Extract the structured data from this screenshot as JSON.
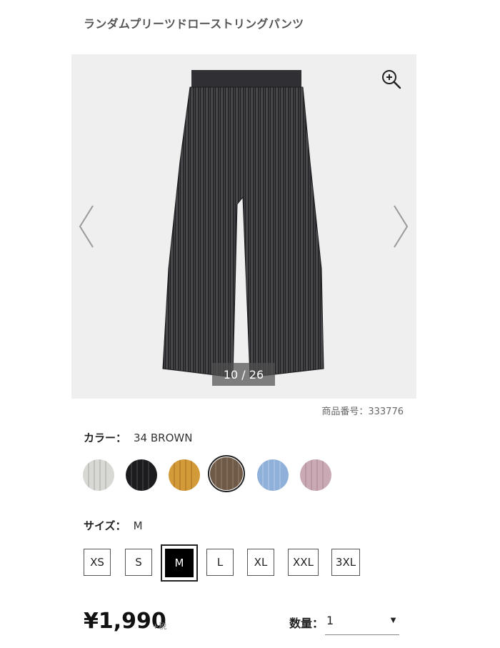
{
  "product": {
    "title": "ランダムプリーツドローストリングパンツ",
    "image_counter": "10 / 26",
    "code_label": "商品番号：333776"
  },
  "color": {
    "label": "カラー：",
    "selected_value": "34 BROWN",
    "swatches": [
      {
        "name": "light-gray",
        "hex": "#d8d8d4"
      },
      {
        "name": "black",
        "hex": "#1c1c1e"
      },
      {
        "name": "mustard",
        "hex": "#d39a3a"
      },
      {
        "name": "brown",
        "hex": "#6f5a48"
      },
      {
        "name": "light-blue",
        "hex": "#8fb0d8"
      },
      {
        "name": "pink",
        "hex": "#c9aab4"
      }
    ]
  },
  "size": {
    "label": "サイズ：",
    "selected_value": "M",
    "options": [
      "XS",
      "S",
      "M",
      "L",
      "XL",
      "XXL",
      "3XL"
    ]
  },
  "price": {
    "amount": "¥1,990",
    "tax_note": "+税"
  },
  "quantity": {
    "label": "数量：",
    "value": "1"
  },
  "icons": [
    "zoom-in-icon",
    "chevron-left-icon",
    "chevron-right-icon",
    "caret-down-icon"
  ]
}
